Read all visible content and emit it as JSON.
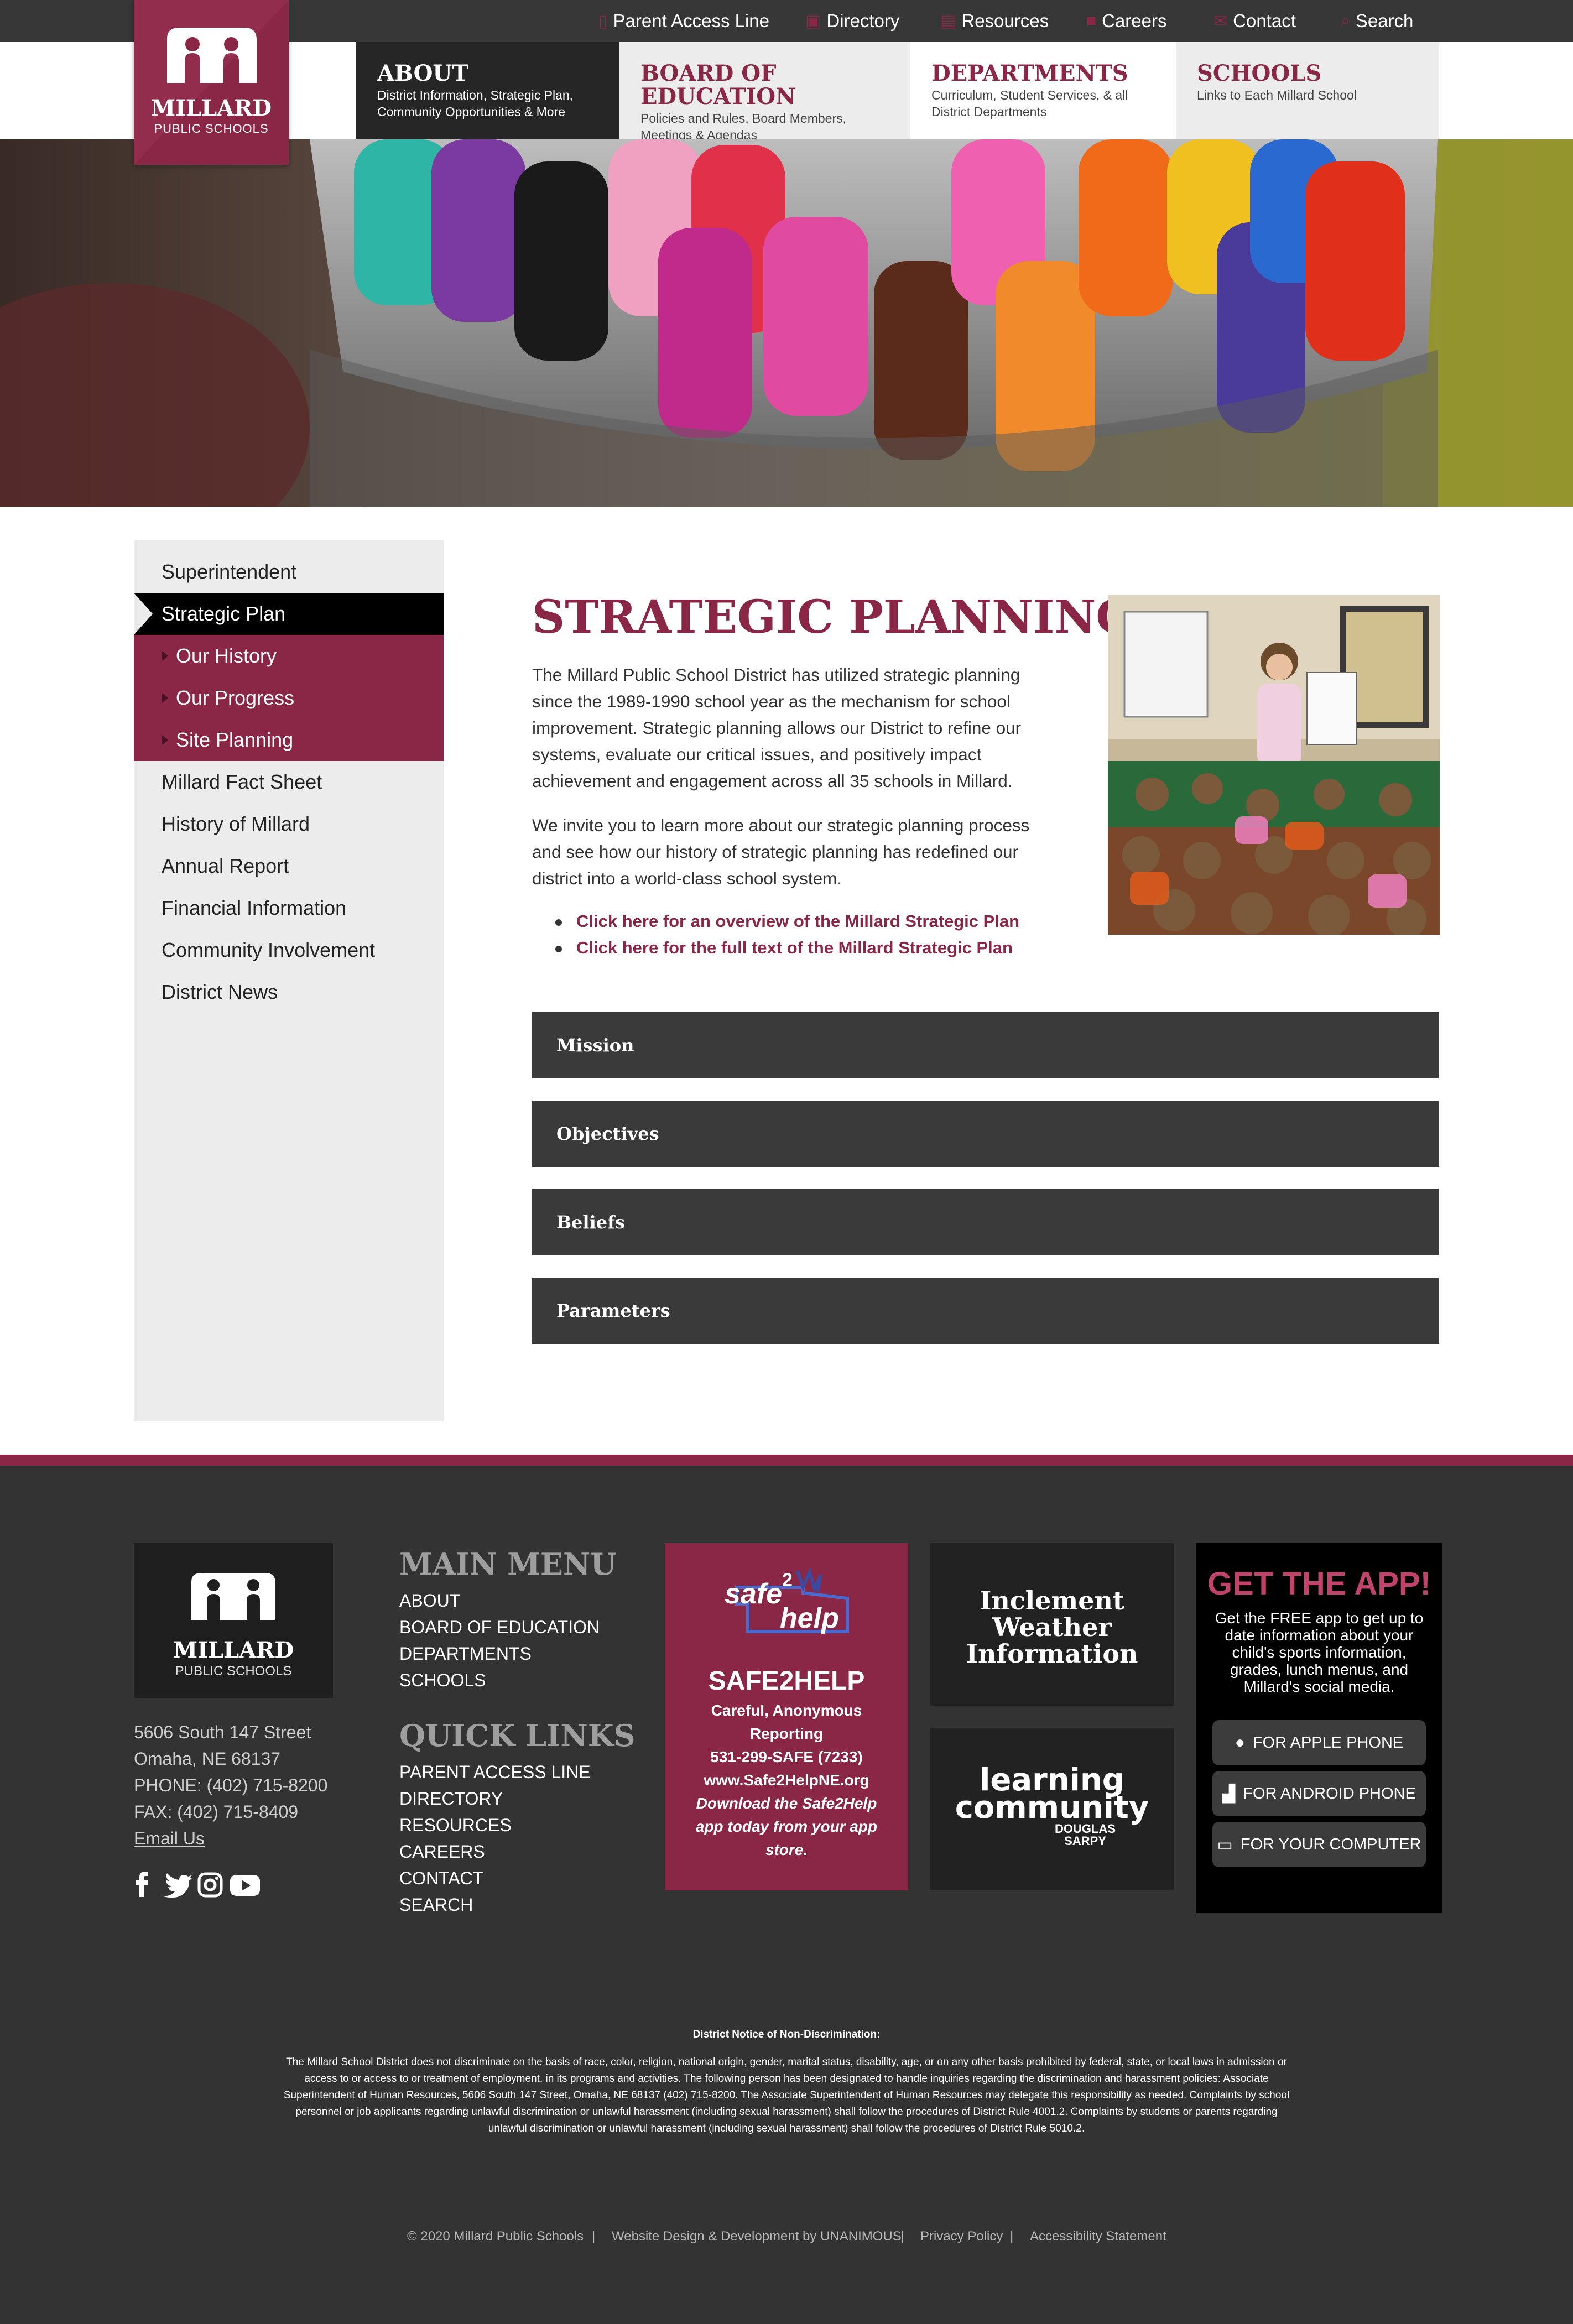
{
  "utility_nav": [
    {
      "label": "Parent Access Line",
      "icon": "phone-icon"
    },
    {
      "label": "Directory",
      "icon": "directory-icon"
    },
    {
      "label": "Resources",
      "icon": "document-icon"
    },
    {
      "label": "Careers",
      "icon": "briefcase-icon"
    },
    {
      "label": "Contact",
      "icon": "envelope-icon"
    },
    {
      "label": "Search",
      "icon": "search-icon"
    }
  ],
  "logo": {
    "name": "MILLARD",
    "sub": "PUBLIC SCHOOLS"
  },
  "main_nav": [
    {
      "title": "ABOUT",
      "subtitle_lines": [
        "District Information, Strategic Plan,",
        "Community Opportunities & More"
      ]
    },
    {
      "title": "BOARD OF EDUCATION",
      "subtitle_lines": [
        "Policies and Rules, Board Members,",
        "Meetings & Agendas"
      ]
    },
    {
      "title": "DEPARTMENTS",
      "subtitle_lines": [
        "Curriculum, Student Services, & all",
        "District Departments"
      ]
    },
    {
      "title": "SCHOOLS",
      "subtitle_lines": [
        "Links to Each Millard School",
        ""
      ]
    }
  ],
  "sidebar": {
    "items": [
      {
        "label": "Superintendent"
      },
      {
        "label": "Strategic Plan"
      },
      {
        "label": "Our History"
      },
      {
        "label": "Our Progress"
      },
      {
        "label": "Site Planning"
      },
      {
        "label": "Millard Fact Sheet"
      },
      {
        "label": "History of Millard"
      },
      {
        "label": "Annual Report"
      },
      {
        "label": "Financial Information"
      },
      {
        "label": "Community Involvement"
      },
      {
        "label": "District News"
      }
    ]
  },
  "main": {
    "title": "STRATEGIC PLANNING",
    "para1_lines": [
      "The Millard Public School District has utilized strategic planning",
      "since the 1989-1990 school year as the mechanism for school",
      "improvement. Strategic planning allows our District to refine our",
      "systems, evaluate our critical issues, and positively impact",
      "achievement and engagement across all 35 schools in Millard."
    ],
    "para2_lines": [
      "We invite you to learn more about our strategic planning process",
      "and see how our history of strategic planning has redefined our",
      "district into a world-class school system."
    ],
    "links": [
      "Click here for an overview of the Millard Strategic Plan",
      "Click here for the full text of the Millard Strategic Plan"
    ],
    "accordions": [
      "Mission",
      "Objectives",
      "Beliefs",
      "Parameters"
    ]
  },
  "footer": {
    "address_lines": [
      "5606 South 147 Street",
      "Omaha, NE 68137",
      "PHONE: (402) 715-8200",
      "FAX: (402) 715-8409"
    ],
    "email_label": "Email Us",
    "social_icons": [
      "facebook-icon",
      "twitter-icon",
      "instagram-icon",
      "youtube-icon"
    ],
    "main_menu_heading": "MAIN MENU",
    "main_menu": [
      "ABOUT",
      "BOARD OF EDUCATION",
      "DEPARTMENTS",
      "SCHOOLS"
    ],
    "quick_links_heading": "QUICK LINKS",
    "quick_links": [
      "PARENT ACCESS LINE",
      "DIRECTORY",
      "RESOURCES",
      "CAREERS",
      "CONTACT",
      "SEARCH"
    ],
    "safe2help": {
      "logo_top": "safe",
      "logo_num": "2",
      "logo_bottom": "help",
      "title": "SAFE2HELP",
      "lines": [
        "Careful, Anonymous",
        "Reporting",
        "531-299-SAFE (7233)",
        "www.Safe2HelpNE.org"
      ],
      "italic_lines": [
        "Download the Safe2Help",
        "app today from your app",
        "store."
      ]
    },
    "weather_lines": [
      "Inclement",
      "Weather",
      "Information"
    ],
    "learning": {
      "line1": "learning",
      "line2": "community",
      "line3": "DOUGLAS",
      "line4": "SARPY"
    },
    "app": {
      "heading": "GET THE APP!",
      "lines": [
        "Get the FREE app to get up to",
        "date information about your",
        "child's sports information,",
        "grades, lunch menus, and",
        "Millard's social media."
      ],
      "buttons": [
        {
          "label": "FOR APPLE PHONE",
          "icon": "apple-icon"
        },
        {
          "label": "FOR ANDROID PHONE",
          "icon": "android-icon"
        },
        {
          "label": "FOR YOUR COMPUTER",
          "icon": "laptop-icon"
        }
      ]
    },
    "notice_heading": "District Notice of Non-Discrimination:",
    "notice_lines": [
      "The Millard School District does not discriminate on the basis of race, color, religion, national origin, gender, marital status, disability, age, or on any other basis prohibited by federal, state, or local laws in admission or",
      "access to or access to or treatment of employment, in its programs and activities. The following person has been designated to handle inquiries regarding the discrimination and harassment policies: Associate",
      "Superintendent of Human Resources, 5606 South 147 Street, Omaha, NE 68137 (402) 715-8200. The Associate Superintendent of Human Resources may delegate this responsibility as needed. Complaints by school",
      "personnel or job applicants regarding unlawful discrimination or unlawful harassment (including sexual harassment) shall follow the procedures of District Rule 4001.2. Complaints by students or parents regarding",
      "unlawful discrimination or unlawful harassment (including sexual harassment) shall follow the procedures of District Rule 5010.2."
    ],
    "copyright": "© 2020 Millard Public Schools",
    "design_credit": "Website Design & Development by UNANIMOUS",
    "privacy": "Privacy Policy",
    "accessibility": "Accessibility Statement",
    "separator": "|"
  },
  "colors": {
    "brand": "#8b2746",
    "dark": "#373737",
    "footer": "#333333"
  }
}
